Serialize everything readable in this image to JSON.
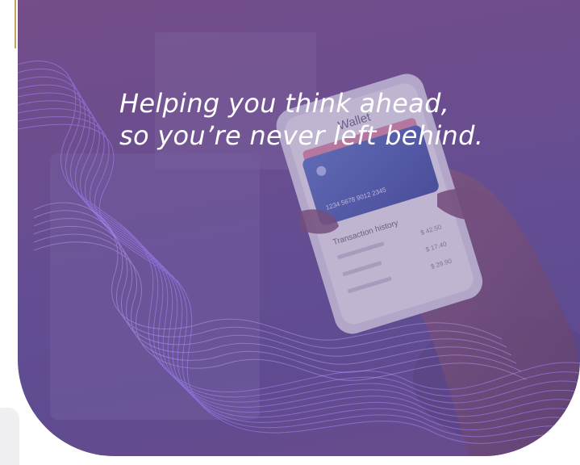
{
  "hero": {
    "headline_line1": "Helping you think ahead,",
    "headline_line2": "so you’re never left behind."
  },
  "phone": {
    "app_title": "Wallet",
    "card_number": "1234 5678 9012 2345",
    "section_title": "Transaction history",
    "amounts": [
      "$ 42.50",
      "$ 17.40",
      "$ 29.90"
    ]
  },
  "colors": {
    "overlay": "#6a4d8f",
    "wave": "#9a6cf0",
    "accent_rule": "#c9a35a"
  }
}
